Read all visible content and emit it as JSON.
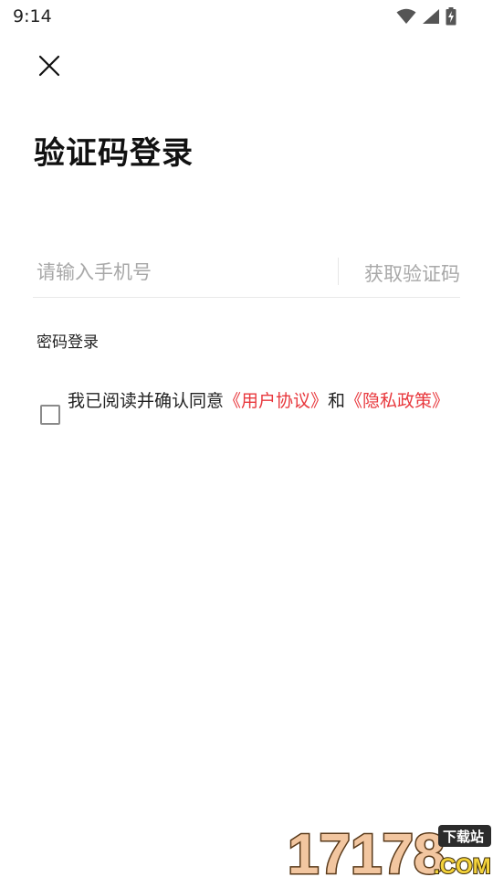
{
  "status_bar": {
    "time": "9:14",
    "icons": [
      "wifi-icon",
      "signal-icon",
      "battery-charging-icon"
    ]
  },
  "header": {
    "close_icon": "close-icon",
    "title": "验证码登录"
  },
  "phone_form": {
    "phone_placeholder": "请输入手机号",
    "phone_value": "",
    "get_code_label": "获取验证码"
  },
  "alt_login": {
    "password_login_label": "密码登录"
  },
  "agreement": {
    "checked": false,
    "prefix": "我已阅读并确认同意",
    "user_agreement": "《用户协议》",
    "and_text": "和",
    "privacy_policy": "《隐私政策》"
  },
  "watermark": {
    "digits": "17178",
    "suffix": ".COM",
    "tag": "下载站"
  },
  "colors": {
    "accent_red": "#e8383d",
    "placeholder_gray": "#a8a8a8",
    "title_black": "#111111"
  }
}
